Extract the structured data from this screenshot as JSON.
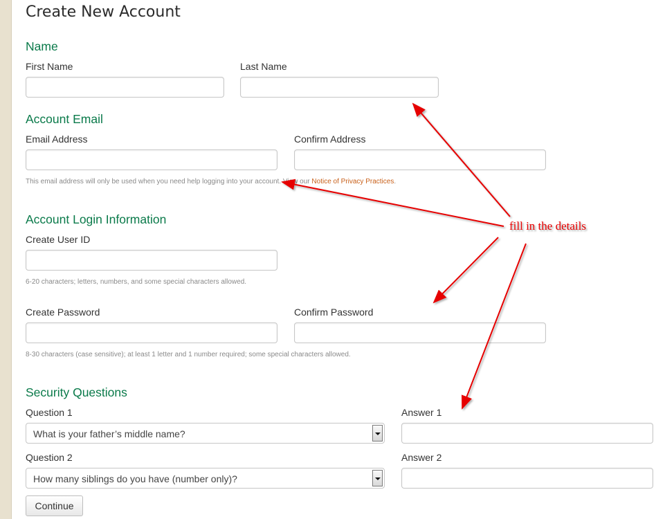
{
  "page": {
    "title": "Create New Account"
  },
  "sections": {
    "name": {
      "title": "Name",
      "first_name_label": "First Name",
      "first_name_value": "",
      "last_name_label": "Last Name",
      "last_name_value": ""
    },
    "email": {
      "title": "Account Email",
      "email_label": "Email Address",
      "email_value": "",
      "confirm_label": "Confirm Address",
      "confirm_value": "",
      "help_text": "This email address will only be used when you need help logging into your account. View our ",
      "privacy_link": "Notice of Privacy Practices",
      "help_suffix": "."
    },
    "login": {
      "title": "Account Login Information",
      "userid_label": "Create User ID",
      "userid_value": "",
      "userid_help": "6-20 characters; letters, numbers, and some special characters allowed.",
      "password_label": "Create Password",
      "password_value": "",
      "confirm_password_label": "Confirm Password",
      "confirm_password_value": "",
      "password_help": "8-30 characters (case sensitive); at least 1 letter and 1 number required; some special characters allowed."
    },
    "security": {
      "title": "Security Questions",
      "question1_label": "Question 1",
      "question1_selected": "What is your father’s middle name?",
      "answer1_label": "Answer 1",
      "answer1_value": "",
      "question2_label": "Question 2",
      "question2_selected": "How many siblings do you have (number only)?",
      "answer2_label": "Answer 2",
      "answer2_value": ""
    }
  },
  "actions": {
    "continue_label": "Continue"
  },
  "annotation": {
    "text": "fill in the details",
    "color": "#e60000"
  },
  "colors": {
    "section_title": "#0a7a4a",
    "link": "#c8601a",
    "sidebar": "#e8e1cf"
  }
}
